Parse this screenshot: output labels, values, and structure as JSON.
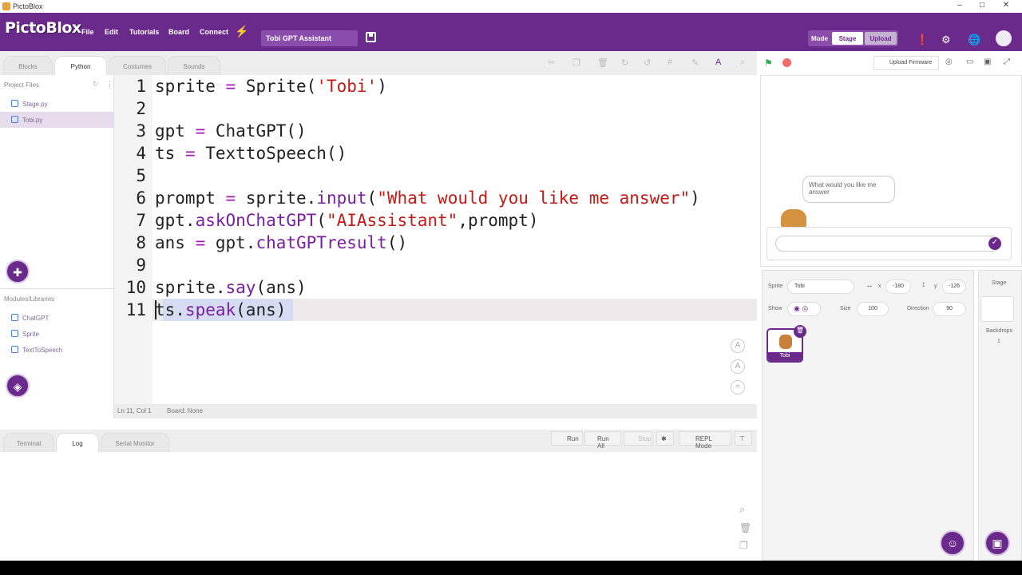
{
  "window": {
    "title": "PictoBlox",
    "controls": [
      "–",
      "□",
      "✕"
    ]
  },
  "menubar": {
    "brand": "PictoBlox",
    "items": [
      "File",
      "Edit",
      "Tutorials",
      "Board",
      "Connect"
    ],
    "project_name": "Tobi GPT Assistant",
    "mode_label": "Mode",
    "mode_stage": "Stage",
    "mode_upload": "Upload"
  },
  "tabs": [
    "Blocks",
    "Python",
    "Costumes",
    "Sounds"
  ],
  "toolbar": {
    "upload_firmware": "Upload Firmware"
  },
  "files": {
    "header": "Project Files",
    "items": [
      "Stage.py",
      "Tobi.py"
    ],
    "modules_header": "Modules/Libraries",
    "modules": [
      "ChatGPT",
      "Sprite",
      "TextToSpeech"
    ]
  },
  "editor": {
    "line_numbers": [
      "1",
      "2",
      "3",
      "4",
      "5",
      "6",
      "7",
      "8",
      "9",
      "10",
      "11"
    ],
    "status_pos": "Ln 11, Col 1",
    "status_board": "Board: None"
  },
  "terminal": {
    "tabs": [
      "Terminal",
      "Log",
      "Serial Monitor"
    ],
    "buttons": [
      "Run",
      "Run All",
      "Stop",
      "REPL Mode"
    ]
  },
  "stage": {
    "bubble_text": "What would you like me answer"
  },
  "sprite_panel": {
    "sprite_label": "Sprite",
    "sprite_name": "Tobi",
    "x_label": "x",
    "x_value": "-180",
    "y_label": "y",
    "y_value": "-126",
    "show_label": "Show",
    "size_label": "Size",
    "size_value": "100",
    "direction_label": "Direction",
    "direction_value": "90",
    "thumb_name": "Tobi"
  },
  "stage_col": {
    "title": "Stage",
    "backdrops_label": "Backdrops",
    "backdrops_count": "1"
  },
  "colors": {
    "brand": "#6a2a8c",
    "keyword": "#a31bb4",
    "string": "#c41a16"
  }
}
